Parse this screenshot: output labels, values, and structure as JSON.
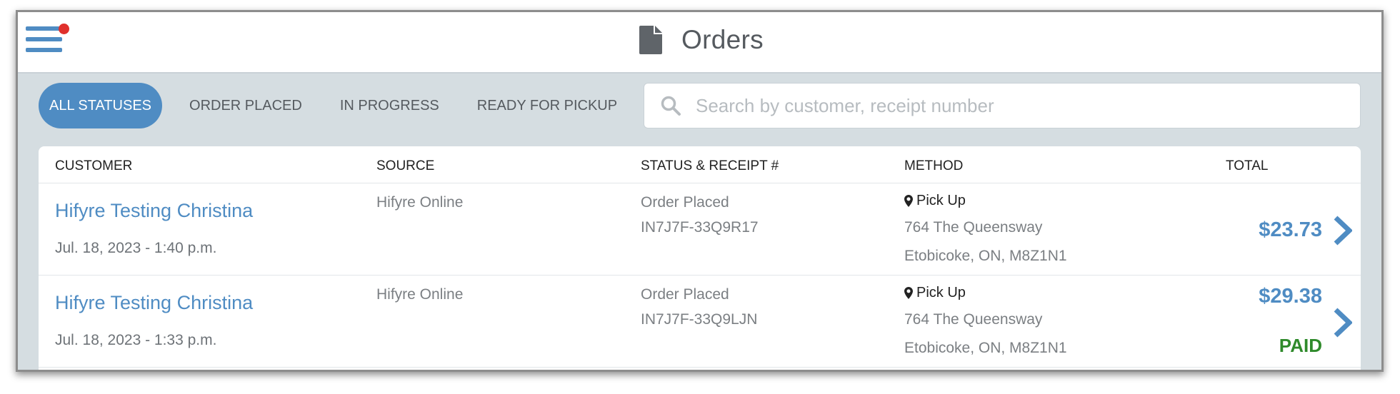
{
  "header": {
    "title": "Orders"
  },
  "filters": [
    {
      "label": "ALL STATUSES",
      "active": true
    },
    {
      "label": "ORDER PLACED",
      "active": false
    },
    {
      "label": "IN PROGRESS",
      "active": false
    },
    {
      "label": "READY FOR PICKUP",
      "active": false
    }
  ],
  "search": {
    "placeholder": "Search by customer, receipt number",
    "value": ""
  },
  "table": {
    "columns": [
      "CUSTOMER",
      "SOURCE",
      "STATUS & RECEIPT #",
      "METHOD",
      "TOTAL"
    ],
    "rows": [
      {
        "customer": "Hifyre Testing Christina",
        "date": "Jul. 18, 2023 - 1:40 p.m.",
        "source": "Hifyre Online",
        "status": "Order Placed",
        "receipt": "IN7J7F-33Q9R17",
        "method": "Pick Up",
        "address_line1": "764 The Queensway",
        "address_line2": "Etobicoke, ON, M8Z1N1",
        "total": "$23.73",
        "payment": ""
      },
      {
        "customer": "Hifyre Testing Christina",
        "date": "Jul. 18, 2023 - 1:33 p.m.",
        "source": "Hifyre Online",
        "status": "Order Placed",
        "receipt": "IN7J7F-33Q9LJN",
        "method": "Pick Up",
        "address_line1": "764 The Queensway",
        "address_line2": "Etobicoke, ON, M8Z1N1",
        "total": "$29.38",
        "payment": "PAID"
      }
    ]
  },
  "icons": {
    "menu": "hamburger-icon",
    "title": "document-icon",
    "search": "search-icon",
    "method": "map-pin-icon",
    "row_action": "chevron-right-icon"
  },
  "colors": {
    "accent": "#4f8cc3",
    "paid": "#2f8a2b",
    "notification": "#e0302c",
    "page_background": "#d5dde1"
  }
}
